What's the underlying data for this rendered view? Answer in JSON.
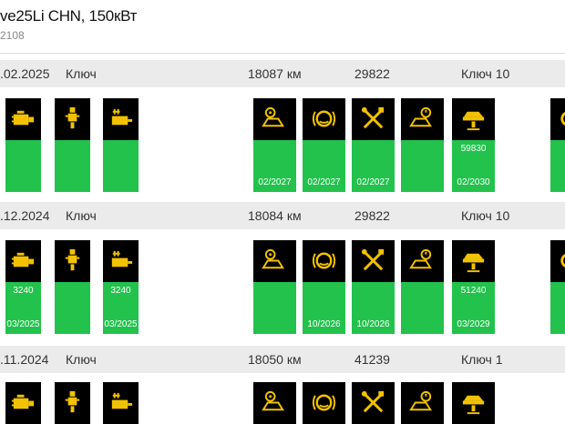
{
  "header": {
    "title": "ve25Li CHN, 150кВт",
    "subtitle": "2108"
  },
  "records": [
    {
      "date": ".02.2025",
      "type": "Ключ",
      "mileage": "18087 км",
      "code": "29822",
      "key_label": "Ключ 10",
      "tiles": {
        "filter": {
          "v1": "",
          "v2": ""
        },
        "spark": {
          "v1": "",
          "v2": ""
        },
        "particulate": {
          "v1": "",
          "v2": ""
        },
        "brake_service": {
          "v1": "",
          "v2": "02/2027"
        },
        "brake_fluid": {
          "v1": "",
          "v2": "02/2027"
        },
        "tools": {
          "v1": "",
          "v2": "02/2027"
        },
        "car_check": {
          "v1": "",
          "v2": ""
        },
        "lift": {
          "v1": "59830",
          "v2": "02/2030"
        }
      }
    },
    {
      "date": ".12.2024",
      "type": "Ключ",
      "mileage": "18084 км",
      "code": "29822",
      "key_label": "Ключ 10",
      "tiles": {
        "filter": {
          "v1": "3240",
          "v2": "03/2025"
        },
        "spark": {
          "v1": "",
          "v2": ""
        },
        "particulate": {
          "v1": "3240",
          "v2": "03/2025"
        },
        "brake_service": {
          "v1": "",
          "v2": ""
        },
        "brake_fluid": {
          "v1": "",
          "v2": "10/2026"
        },
        "tools": {
          "v1": "",
          "v2": "10/2026"
        },
        "car_check": {
          "v1": "",
          "v2": ""
        },
        "lift": {
          "v1": "51240",
          "v2": "03/2029"
        }
      }
    },
    {
      "date": ".11.2024",
      "type": "Ключ",
      "mileage": "18050 км",
      "code": "41239",
      "key_label": "Ключ 1"
    }
  ],
  "icons": {
    "accent": "#f2c200",
    "tile_bg": "#000000",
    "ok_color": "#22c24c"
  }
}
